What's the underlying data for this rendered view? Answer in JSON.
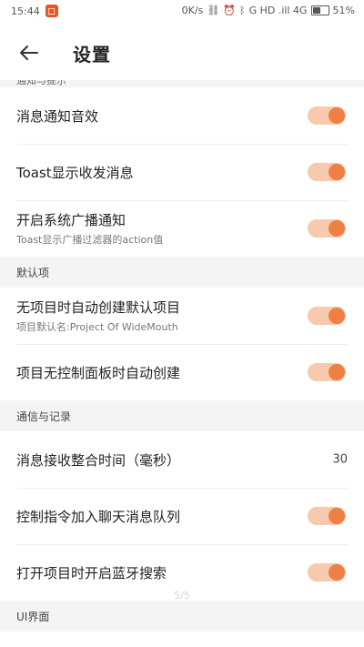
{
  "status_bar": {
    "time": "15:44",
    "app_badge": "口",
    "speed": "0K/s",
    "network": "G HD .ill 4G",
    "battery": "51%",
    "battery_level": 0.51
  },
  "app_bar": {
    "title": "设置"
  },
  "sections": {
    "notify": {
      "header": "通知与提示",
      "items": [
        {
          "title": "消息通知音效"
        },
        {
          "title": "Toast显示收发消息"
        },
        {
          "title": "开启系统广播通知",
          "subtitle": "Toast显示广播过滤器的action值"
        }
      ]
    },
    "defaults": {
      "header": "默认项",
      "items": [
        {
          "title": "无项目时自动创建默认项目",
          "subtitle": "项目默认名:Project Of WideMouth"
        },
        {
          "title": "项目无控制面板时自动创建"
        }
      ]
    },
    "comm": {
      "header": "通信与记录",
      "items": [
        {
          "title": "消息接收整合时间（毫秒）",
          "value": "30"
        },
        {
          "title": "控制指令加入聊天消息队列"
        },
        {
          "title": "打开项目时开启蓝牙搜索"
        }
      ]
    },
    "ui": {
      "header": "UI界面"
    }
  },
  "page_indicator": "5/5",
  "colors": {
    "accent": "#ee7f45",
    "track": "#f7c9ad",
    "section_bg": "#f4f4f4"
  }
}
